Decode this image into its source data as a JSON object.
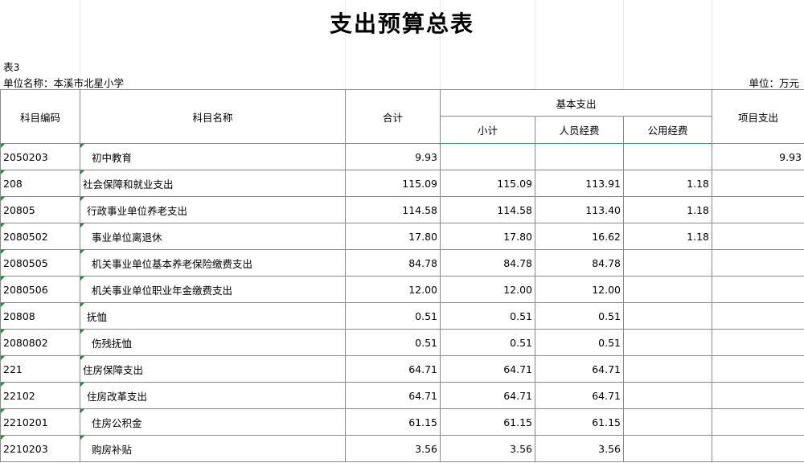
{
  "title": "支出预算总表",
  "table_no": "表3",
  "unit_name": "单位名称：本溪市北星小学",
  "unit_money": "单位：万元",
  "headers": {
    "code": "科目编码",
    "name": "科目名称",
    "total": "合计",
    "basic": "基本支出",
    "subtotal": "小计",
    "personnel": "人员经费",
    "public": "公用经费",
    "project": "项目支出"
  },
  "rows": [
    {
      "code": "2050203",
      "name": "初中教育",
      "indent": 2,
      "total": "9.93",
      "subtotal": "",
      "personnel": "",
      "public": "",
      "project": "9.93"
    },
    {
      "code": "208",
      "name": "社会保障和就业支出",
      "indent": 0,
      "total": "115.09",
      "subtotal": "115.09",
      "personnel": "113.91",
      "public": "1.18",
      "project": ""
    },
    {
      "code": "20805",
      "name": "行政事业单位养老支出",
      "indent": 1,
      "total": "114.58",
      "subtotal": "114.58",
      "personnel": "113.40",
      "public": "1.18",
      "project": ""
    },
    {
      "code": "2080502",
      "name": "事业单位离退休",
      "indent": 2,
      "total": "17.80",
      "subtotal": "17.80",
      "personnel": "16.62",
      "public": "1.18",
      "project": ""
    },
    {
      "code": "2080505",
      "name": "机关事业单位基本养老保险缴费支出",
      "indent": 2,
      "total": "84.78",
      "subtotal": "84.78",
      "personnel": "84.78",
      "public": "",
      "project": ""
    },
    {
      "code": "2080506",
      "name": "机关事业单位职业年金缴费支出",
      "indent": 2,
      "total": "12.00",
      "subtotal": "12.00",
      "personnel": "12.00",
      "public": "",
      "project": ""
    },
    {
      "code": "20808",
      "name": "抚恤",
      "indent": 1,
      "total": "0.51",
      "subtotal": "0.51",
      "personnel": "0.51",
      "public": "",
      "project": ""
    },
    {
      "code": "2080802",
      "name": "伤残抚恤",
      "indent": 2,
      "total": "0.51",
      "subtotal": "0.51",
      "personnel": "0.51",
      "public": "",
      "project": ""
    },
    {
      "code": "221",
      "name": "住房保障支出",
      "indent": 0,
      "total": "64.71",
      "subtotal": "64.71",
      "personnel": "64.71",
      "public": "",
      "project": ""
    },
    {
      "code": "22102",
      "name": "住房改革支出",
      "indent": 1,
      "total": "64.71",
      "subtotal": "64.71",
      "personnel": "64.71",
      "public": "",
      "project": ""
    },
    {
      "code": "2210201",
      "name": "住房公积金",
      "indent": 2,
      "total": "61.15",
      "subtotal": "61.15",
      "personnel": "61.15",
      "public": "",
      "project": ""
    },
    {
      "code": "2210203",
      "name": "购房补贴",
      "indent": 2,
      "total": "3.56",
      "subtotal": "3.56",
      "personnel": "3.56",
      "public": "",
      "project": ""
    }
  ]
}
